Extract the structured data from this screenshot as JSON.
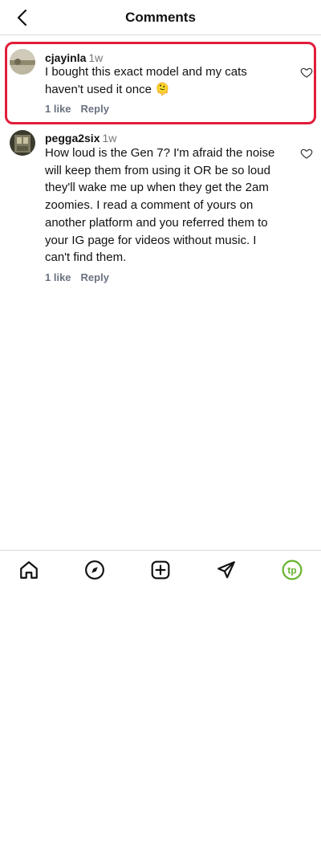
{
  "header": {
    "title": "Comments",
    "back_icon": "chevron-left-icon"
  },
  "comments": [
    {
      "username": "cjayinla",
      "time": "1w",
      "text": "I bought this exact model and my cats haven't used it once 🫠",
      "likes": "1 like",
      "reply": "Reply",
      "highlighted": true,
      "highlight_color": "#e11d3a"
    },
    {
      "username": "pegga2six",
      "time": "1w",
      "text": "How loud is the Gen 7? I'm afraid the noise will keep them from using it OR be so loud they'll wake me up when they get the 2am zoomies. I read a comment of yours on another platform and you referred them to your IG page for videos without music. I can't find them.",
      "likes": "1 like",
      "reply": "Reply",
      "highlighted": false
    }
  ],
  "bottom_nav": [
    {
      "icon": "home-icon"
    },
    {
      "icon": "compass-icon"
    },
    {
      "icon": "add-post-icon"
    },
    {
      "icon": "send-icon"
    },
    {
      "icon": "profile-avatar-icon",
      "label": "tp",
      "accent": "#65b32e"
    }
  ]
}
